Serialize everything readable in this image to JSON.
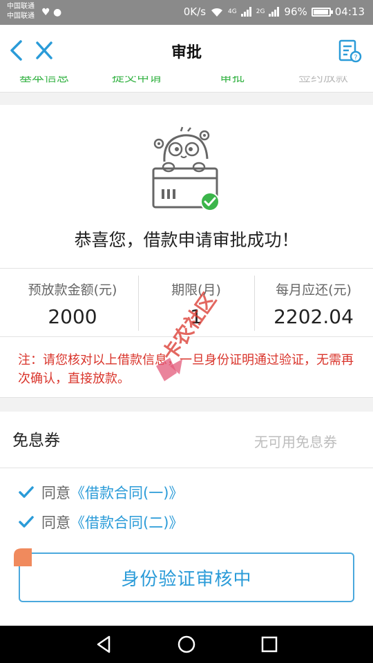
{
  "status_bar": {
    "carrier_1": "中国联通",
    "carrier_2": "中国联通",
    "net_speed": "0K/s",
    "signal_1": "4G",
    "signal_2": "2G",
    "battery": "96%",
    "time": "04:13"
  },
  "nav": {
    "title": "审批",
    "back_icon": "chevron-left-icon",
    "close_icon": "close-icon",
    "doc_icon": "document-help-icon"
  },
  "steps": [
    "基本信息",
    "提交申请",
    "审批",
    "签约放款"
  ],
  "success": {
    "message": "恭喜您，借款申请审批成功！"
  },
  "stats": [
    {
      "label": "预放款金额(元)",
      "value": "2000"
    },
    {
      "label": "期限(月)",
      "value": "1"
    },
    {
      "label": "每月应还(元)",
      "value": "2202.04"
    }
  ],
  "notice": "注：请您核对以上借款信息，一旦身份证明通过验证，无需再次确认，直接放款。",
  "coupon": {
    "label": "免息券",
    "value": "无可用免息券"
  },
  "agreements": [
    {
      "prefix": "同意",
      "link": "《借款合同(一)》",
      "checked": true
    },
    {
      "prefix": "同意",
      "link": "《借款合同(二)》",
      "checked": true
    }
  ],
  "verify_button": "身份验证审核中",
  "watermark": "卡农社区",
  "colors": {
    "accent": "#2a9bd8",
    "success": "#3bb54a",
    "warning": "#d9342b",
    "badge": "#f08a5d"
  }
}
